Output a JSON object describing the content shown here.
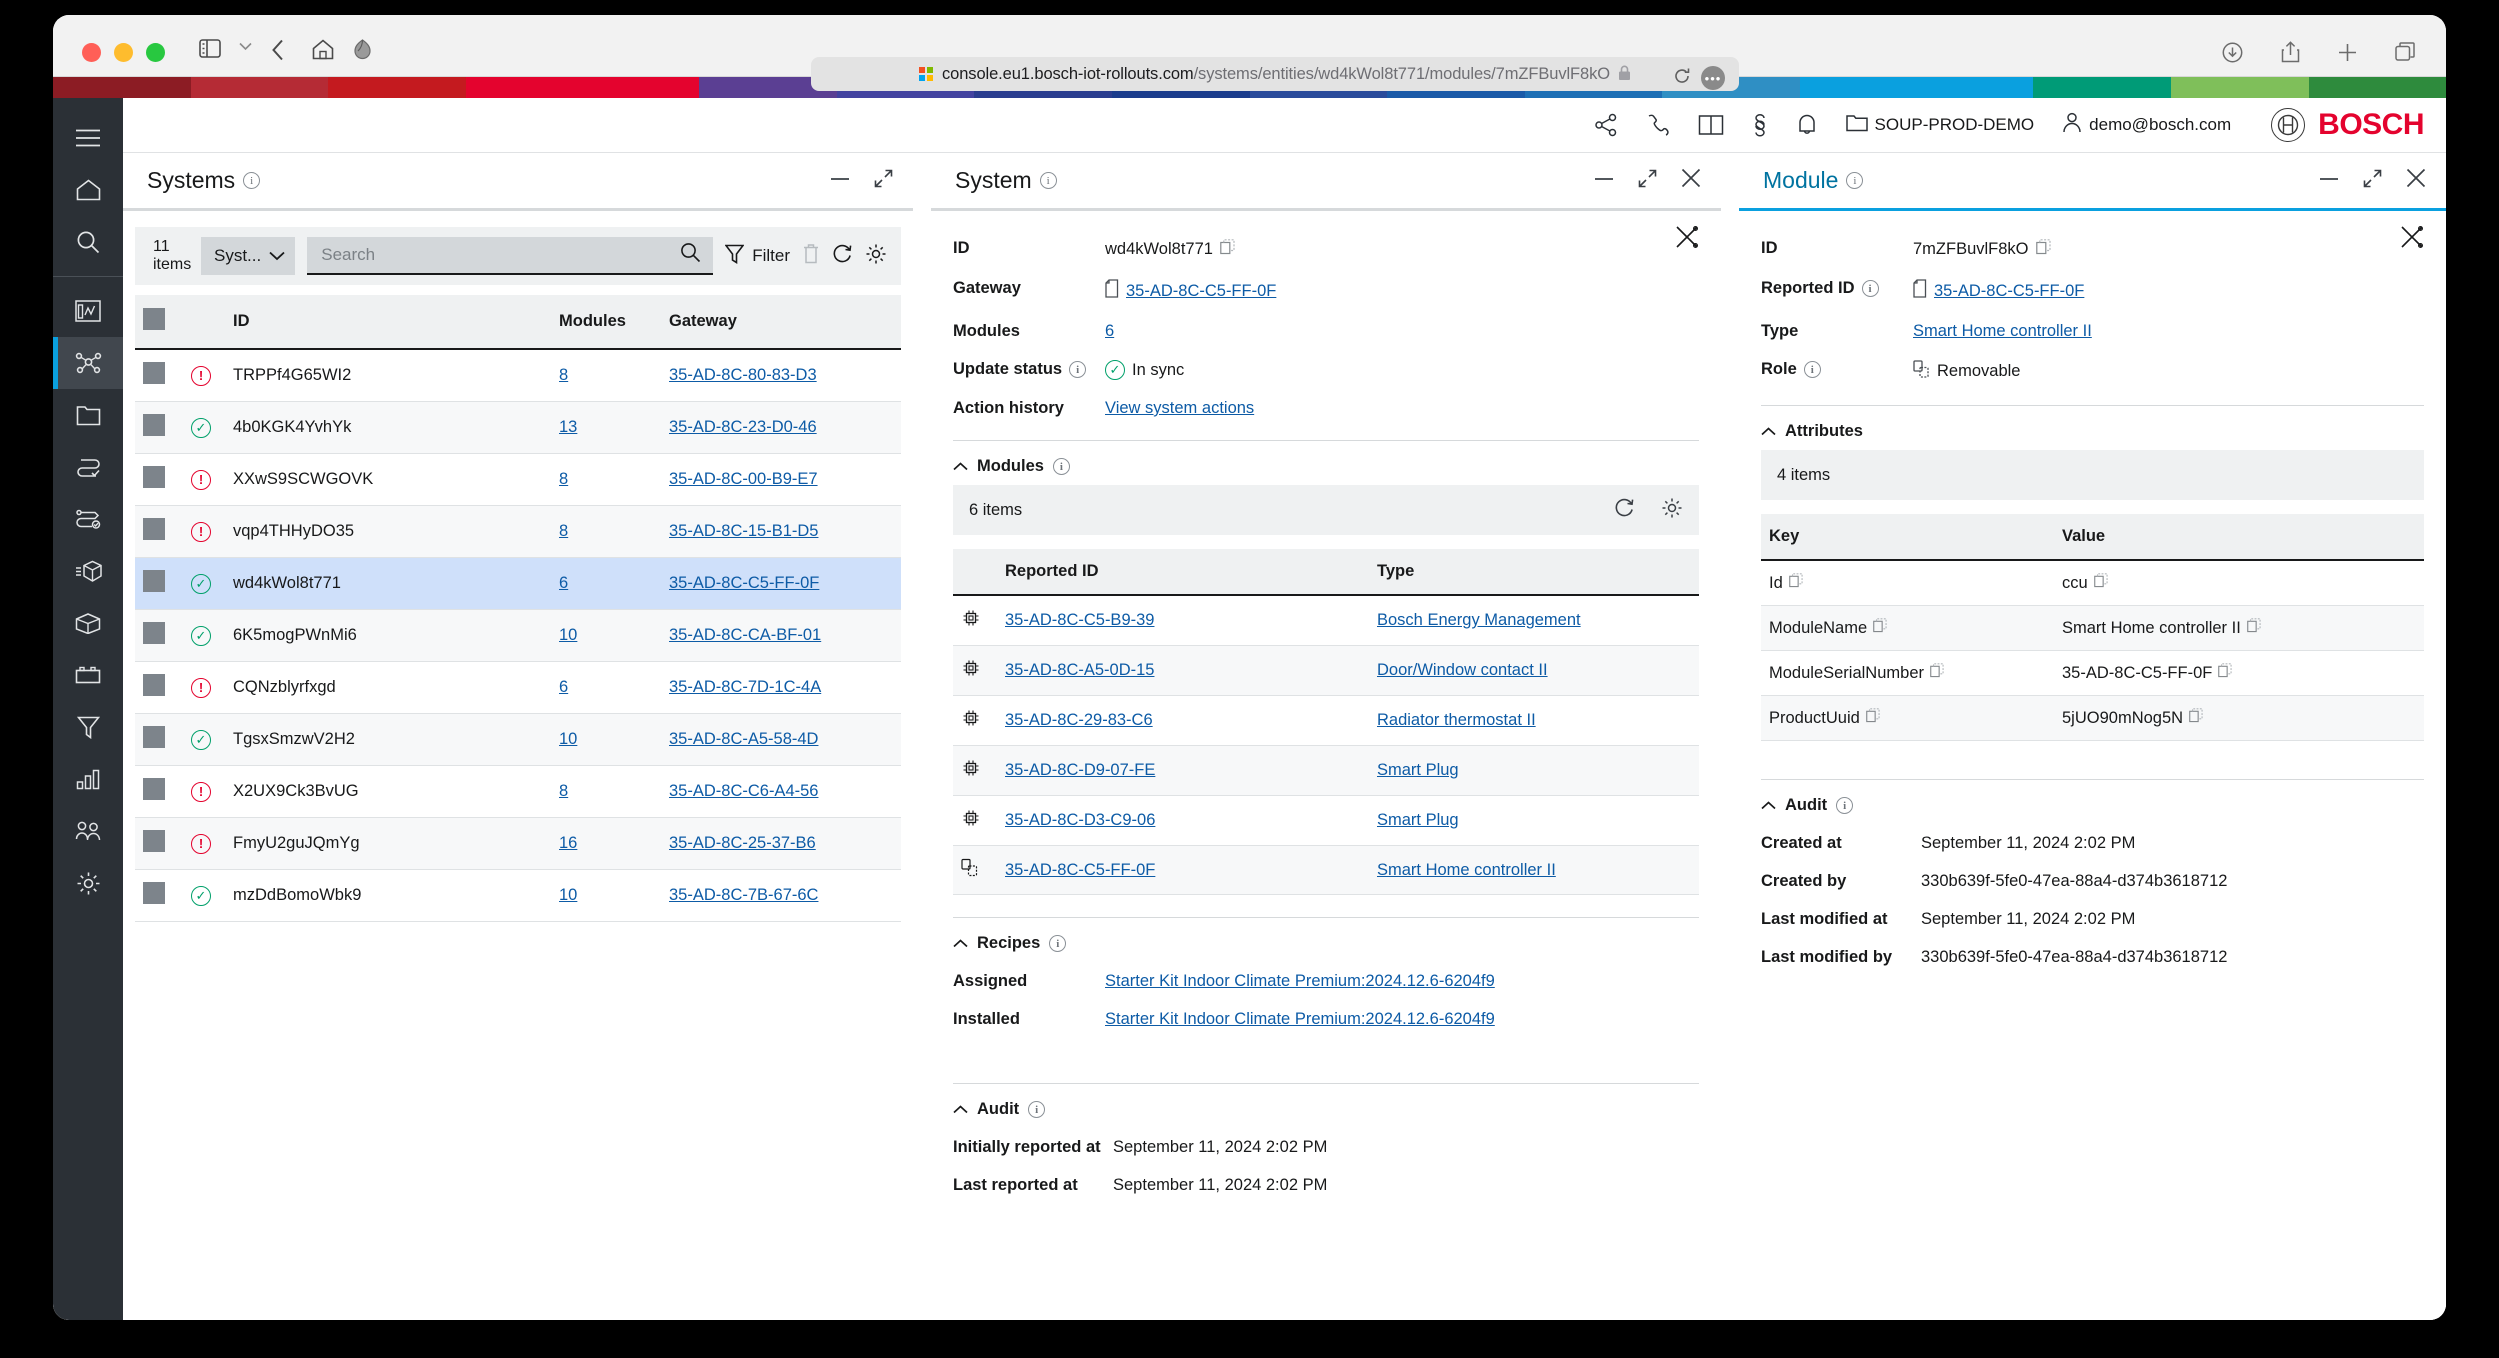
{
  "browser": {
    "url_domain": "console.eu1.bosch-iot-rollouts.com",
    "url_path": "/systems/entities/wd4kWol8t771/modules/7mZFBuvlF8kO",
    "lock": "🔒"
  },
  "appheader": {
    "tenant": "SOUP-PROD-DEMO",
    "user": "demo@bosch.com",
    "brand": "BOSCH"
  },
  "rail": {
    "items": [
      {
        "name": "menu-icon",
        "label": "Menu"
      },
      {
        "name": "home-icon",
        "label": "Home"
      },
      {
        "name": "search-icon",
        "label": "Search"
      },
      {
        "name": "dashboard-icon",
        "label": "Dashboard"
      },
      {
        "name": "systems-icon",
        "label": "Systems"
      },
      {
        "name": "folder-icon",
        "label": "Folder"
      },
      {
        "name": "rollout-icon",
        "label": "Rollouts"
      },
      {
        "name": "actions-icon",
        "label": "Actions"
      },
      {
        "name": "packages-icon",
        "label": "Packages"
      },
      {
        "name": "box-icon",
        "label": "Artifacts"
      },
      {
        "name": "battery-icon",
        "label": "Devices"
      },
      {
        "name": "filter-icon",
        "label": "Target filters"
      },
      {
        "name": "chart-icon",
        "label": "Reports"
      },
      {
        "name": "users-icon",
        "label": "Access"
      },
      {
        "name": "gear-icon",
        "label": "Settings"
      }
    ]
  },
  "systems_panel": {
    "title": "Systems",
    "toolbar": {
      "items_count": "11",
      "items_label": "items",
      "select_value": "Syst...",
      "search_placeholder": "Search",
      "search_value": "",
      "filter_label": "Filter"
    },
    "columns": [
      "",
      "",
      "ID",
      "Modules",
      "Gateway"
    ],
    "rows": [
      {
        "status": "error",
        "id": "TRPPf4G65WI2",
        "modules": "8",
        "gateway": "35-AD-8C-80-83-D3",
        "selected": false
      },
      {
        "status": "ok",
        "id": "4b0KGK4YvhYk",
        "modules": "13",
        "gateway": "35-AD-8C-23-D0-46",
        "selected": false
      },
      {
        "status": "error",
        "id": "XXwS9SCWGOVK",
        "modules": "8",
        "gateway": "35-AD-8C-00-B9-E7",
        "selected": false
      },
      {
        "status": "error",
        "id": "vqp4THHyDO35",
        "modules": "8",
        "gateway": "35-AD-8C-15-B1-D5",
        "selected": false
      },
      {
        "status": "ok",
        "id": "wd4kWol8t771",
        "modules": "6",
        "gateway": "35-AD-8C-C5-FF-0F",
        "selected": true
      },
      {
        "status": "ok",
        "id": "6K5mogPWnMi6",
        "modules": "10",
        "gateway": "35-AD-8C-CA-BF-01",
        "selected": false
      },
      {
        "status": "error",
        "id": "CQNzblyrfxgd",
        "modules": "6",
        "gateway": "35-AD-8C-7D-1C-4A",
        "selected": false
      },
      {
        "status": "ok",
        "id": "TgsxSmzwV2H2",
        "modules": "10",
        "gateway": "35-AD-8C-A5-58-4D",
        "selected": false
      },
      {
        "status": "error",
        "id": "X2UX9Ck3BvUG",
        "modules": "8",
        "gateway": "35-AD-8C-C6-A4-56",
        "selected": false
      },
      {
        "status": "error",
        "id": "FmyU2guJQmYg",
        "modules": "16",
        "gateway": "35-AD-8C-25-37-B6",
        "selected": false
      },
      {
        "status": "ok",
        "id": "mzDdBomoWbk9",
        "modules": "10",
        "gateway": "35-AD-8C-7B-67-6C",
        "selected": false
      }
    ]
  },
  "system_panel": {
    "title": "System",
    "fields": {
      "id_label": "ID",
      "id_value": "wd4kWol8t771",
      "gateway_label": "Gateway",
      "gateway_value": "35-AD-8C-C5-FF-0F",
      "modules_label": "Modules",
      "modules_value": "6",
      "update_status_label": "Update status",
      "update_status_value": "In sync",
      "action_history_label": "Action history",
      "action_history_value": "View system actions"
    },
    "modules_section": {
      "title": "Modules",
      "items_label": "6 items",
      "columns": [
        "",
        "Reported ID",
        "Type"
      ],
      "rows": [
        {
          "icon": "chip-icon",
          "reported_id": "35-AD-8C-C5-B9-39",
          "type": "Bosch Energy Management"
        },
        {
          "icon": "chip-icon",
          "reported_id": "35-AD-8C-A5-0D-15",
          "type": "Door/Window contact II"
        },
        {
          "icon": "chip-icon",
          "reported_id": "35-AD-8C-29-83-C6",
          "type": "Radiator thermostat II"
        },
        {
          "icon": "chip-icon",
          "reported_id": "35-AD-8C-D9-07-FE",
          "type": "Smart Plug"
        },
        {
          "icon": "chip-icon",
          "reported_id": "35-AD-8C-D3-C9-06",
          "type": "Smart Plug"
        },
        {
          "icon": "removable-icon",
          "reported_id": "35-AD-8C-C5-FF-0F",
          "type": "Smart Home controller II"
        }
      ]
    },
    "recipes_section": {
      "title": "Recipes",
      "assigned_label": "Assigned",
      "assigned_value": "Starter Kit Indoor Climate Premium:2024.12.6-6204f9",
      "installed_label": "Installed",
      "installed_value": "Starter Kit Indoor Climate Premium:2024.12.6-6204f9"
    },
    "audit_section": {
      "title": "Audit",
      "initially_reported_label": "Initially reported at",
      "initially_reported_value": "September 11, 2024 2:02 PM",
      "last_reported_label": "Last reported at",
      "last_reported_value": "September 11, 2024 2:02 PM"
    }
  },
  "module_panel": {
    "title": "Module",
    "fields": {
      "id_label": "ID",
      "id_value": "7mZFBuvlF8kO",
      "reported_id_label": "Reported ID",
      "reported_id_value": "35-AD-8C-C5-FF-0F",
      "type_label": "Type",
      "type_value": "Smart Home controller II",
      "role_label": "Role",
      "role_value": "Removable"
    },
    "attributes_section": {
      "title": "Attributes",
      "items_label": "4 items",
      "columns": [
        "Key",
        "Value"
      ],
      "rows": [
        {
          "key": "Id",
          "value": "ccu"
        },
        {
          "key": "ModuleName",
          "value": "Smart Home controller II"
        },
        {
          "key": "ModuleSerialNumber",
          "value": "35-AD-8C-C5-FF-0F"
        },
        {
          "key": "ProductUuid",
          "value": "5jUO90mNog5N"
        }
      ]
    },
    "audit_section": {
      "title": "Audit",
      "created_at_label": "Created at",
      "created_at_value": "September 11, 2024 2:02 PM",
      "created_by_label": "Created by",
      "created_by_value": "330b639f-5fe0-47ea-88a4-d374b3618712",
      "last_modified_at_label": "Last modified at",
      "last_modified_at_value": "September 11, 2024 2:02 PM",
      "last_modified_by_label": "Last modified by",
      "last_modified_by_value": "330b639f-5fe0-47ea-88a4-d374b3618712"
    }
  },
  "colors": {
    "accent": "#0aa0df",
    "brand_red": "#e4032e",
    "link": "#0d5ba6",
    "ok": "#00a06a",
    "error": "#e4032e",
    "rail_bg": "#2b3036",
    "selected_row": "#cfe0fa"
  },
  "supergraphic": [
    "#8c1c24",
    "#b52b35",
    "#c41a1f",
    "#e4032e",
    "#5b3f93",
    "#4343a0",
    "#2a3d8f",
    "#1b3c8c",
    "#2a4b9b",
    "#1a5aa8",
    "#1d6fb5",
    "#2f8fc4",
    "#0aa0df",
    "#009b77",
    "#7fbf5a",
    "#2e8b3d"
  ]
}
